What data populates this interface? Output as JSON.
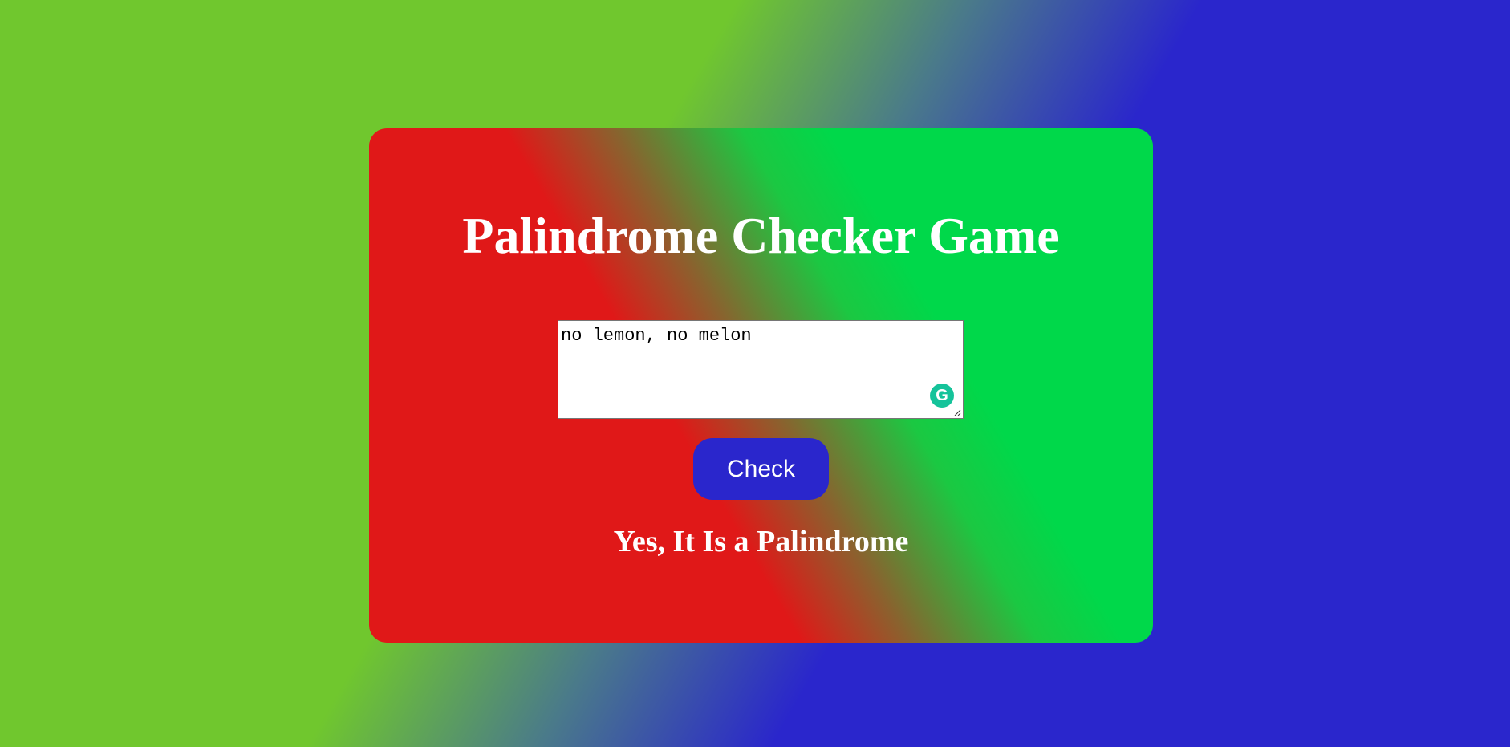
{
  "title": "Palindrome Checker Game",
  "input": {
    "value": "no lemon, no melon",
    "grammar_icon": "grammarly-icon"
  },
  "button": {
    "label": "Check"
  },
  "result": {
    "text": "Yes, It Is a Palindrome"
  },
  "colors": {
    "page_green": "#70c72e",
    "page_blue": "#2a26cc",
    "card_red": "#e01818",
    "card_green": "#00d84a",
    "button_bg": "#2a26cc"
  }
}
